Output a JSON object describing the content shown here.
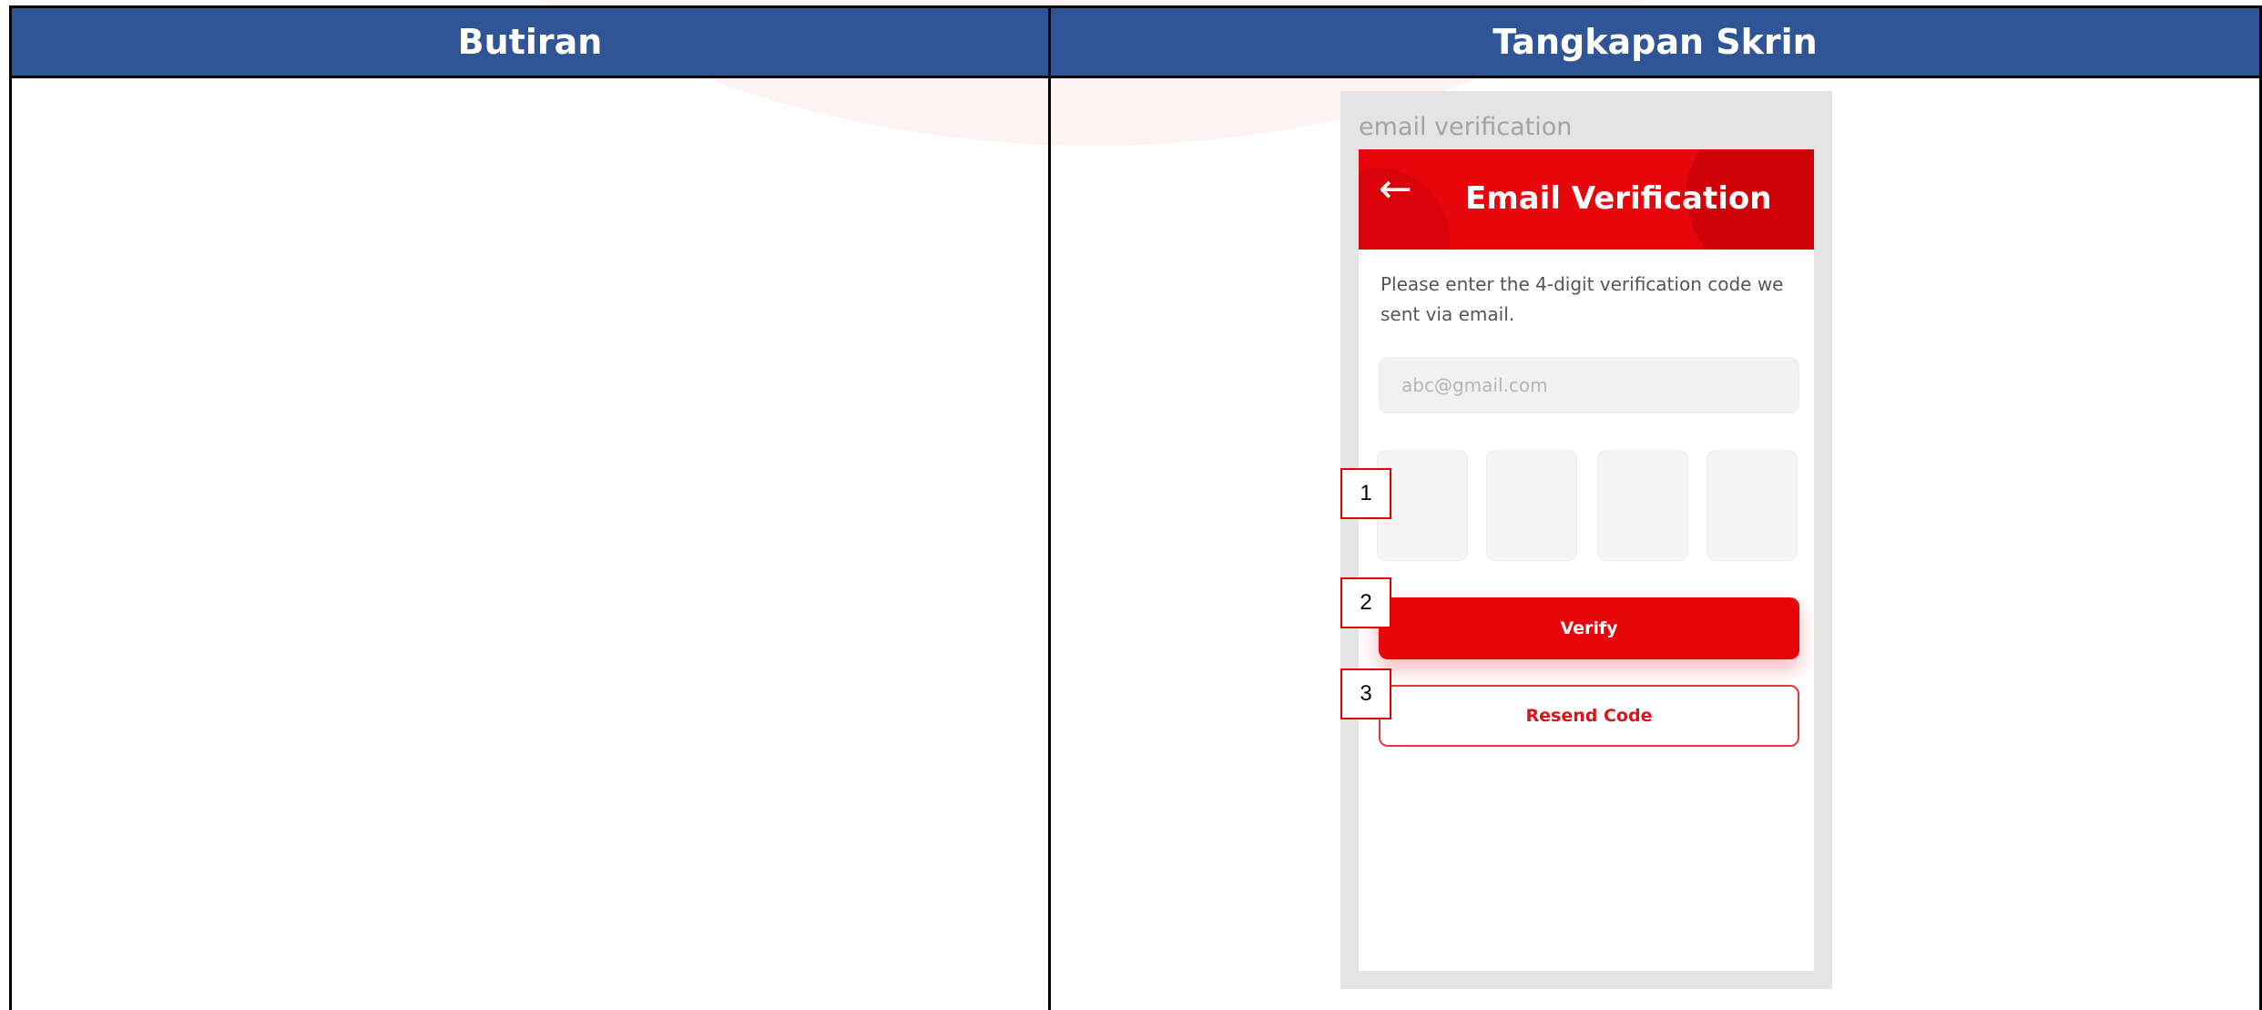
{
  "table": {
    "headers": {
      "left": "Butiran",
      "right": "Tangkapan Skrin"
    }
  },
  "phone": {
    "label": "email verification",
    "header": {
      "back_icon": "←",
      "title": "Email Verification"
    },
    "instruction": "Please enter the 4-digit verification code we sent via email.",
    "email_placeholder": "abc@gmail.com",
    "otp_digits": [
      "",
      "",
      "",
      ""
    ],
    "verify_label": "Verify",
    "resend_label": "Resend Code"
  },
  "callouts": [
    "1",
    "2",
    "3"
  ],
  "colors": {
    "header_blue": "#2f5597",
    "brand_red": "#e8060d",
    "frame_gray": "#e4e4e4",
    "callout_border": "#e00000"
  },
  "icons": {
    "back": "arrow-left-icon"
  }
}
